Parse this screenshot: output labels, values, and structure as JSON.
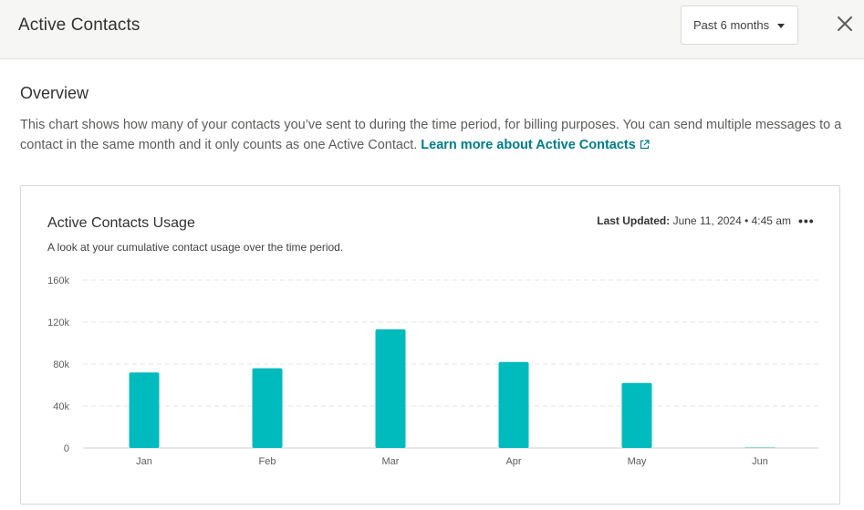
{
  "header": {
    "title": "Active Contacts",
    "period_select": "Past 6 months"
  },
  "overview": {
    "title": "Overview",
    "text": "This chart shows how many of your contacts you’ve sent to during the time period, for billing purposes. You can send multiple messages to a contact in the same month and it only counts as one Active Contact. ",
    "link": "Learn more about Active Contacts"
  },
  "card": {
    "title": "Active Contacts Usage",
    "subtitle": "A look at your cumulative contact usage over the time period.",
    "last_updated_label": "Last Updated:",
    "last_updated_value": " June 11, 2024 • 4:45 am",
    "more_label": "•••"
  },
  "colors": {
    "bar": "#00bbbd",
    "link": "#007c89",
    "grid": "#e4e4e2"
  },
  "chart_data": {
    "type": "bar",
    "categories": [
      "Jan",
      "Feb",
      "Mar",
      "Apr",
      "May",
      "Jun"
    ],
    "values": [
      72000,
      76000,
      113000,
      82000,
      62000,
      0
    ],
    "ylim": [
      0,
      160000
    ],
    "yticks": [
      0,
      40000,
      80000,
      120000,
      160000
    ],
    "ytick_labels": [
      "0",
      "40k",
      "80k",
      "120k",
      "160k"
    ],
    "grid": true,
    "legend": "none"
  }
}
